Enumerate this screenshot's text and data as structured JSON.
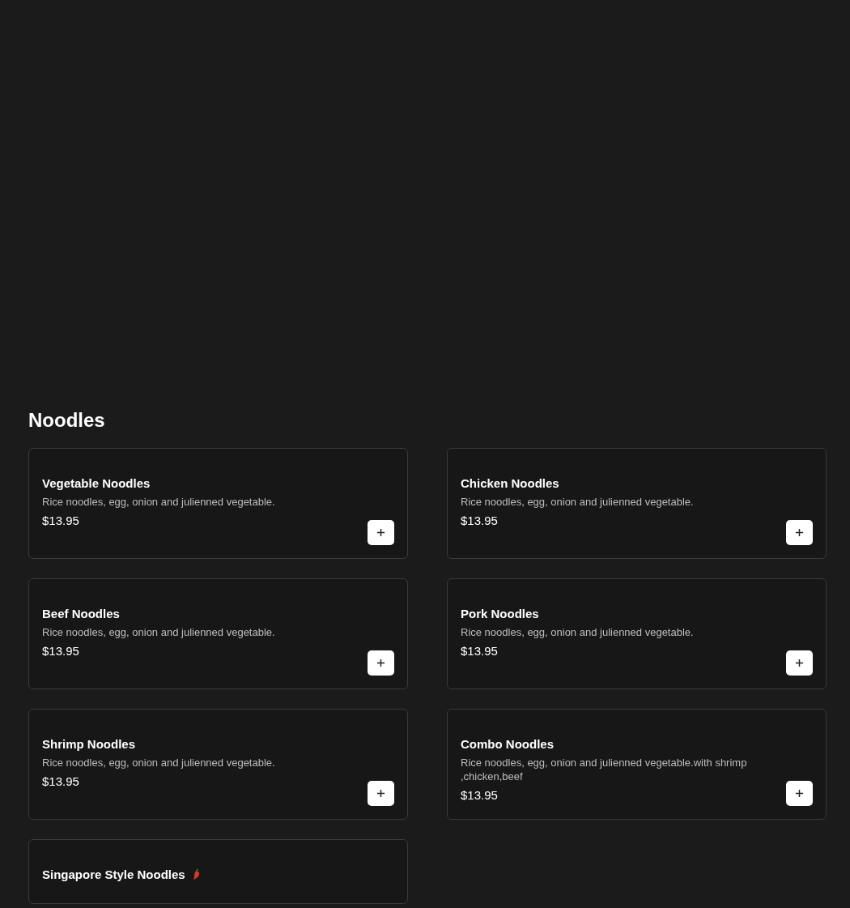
{
  "section": {
    "title": "Noodles"
  },
  "items": [
    {
      "name": "Vegetable Noodles",
      "description": "Rice noodles, egg, onion and julienned vegetable.",
      "price": "$13.95",
      "spicy": false
    },
    {
      "name": "Chicken Noodles",
      "description": "Rice noodles, egg, onion and julienned vegetable.",
      "price": "$13.95",
      "spicy": false
    },
    {
      "name": "Beef Noodles",
      "description": "Rice noodles, egg, onion and julienned vegetable.",
      "price": "$13.95",
      "spicy": false
    },
    {
      "name": "Pork Noodles",
      "description": "Rice noodles, egg, onion and julienned vegetable.",
      "price": "$13.95",
      "spicy": false
    },
    {
      "name": "Shrimp Noodles",
      "description": "Rice noodles, egg, onion and julienned vegetable.",
      "price": "$13.95",
      "spicy": false
    },
    {
      "name": "Combo Noodles",
      "description": "Rice noodles, egg, onion and julienned vegetable.with shrimp ,chicken,beef",
      "price": "$13.95",
      "spicy": false
    },
    {
      "name": "Singapore Style Noodles",
      "spicy": true
    }
  ]
}
